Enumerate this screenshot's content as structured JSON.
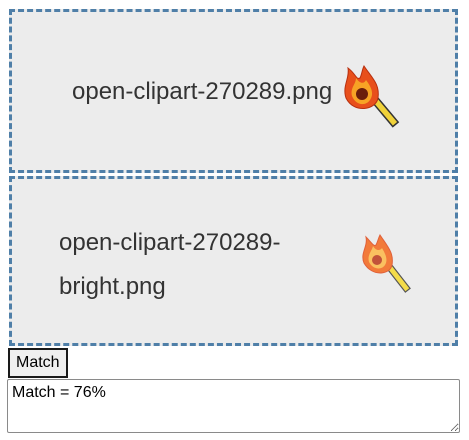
{
  "images": [
    {
      "filename": "open-clipart-270289.png",
      "icon": "match-stick-fire-icon"
    },
    {
      "filename": "open-clipart-270289-bright.png",
      "filename_line1": "open-clipart-270289-",
      "filename_line2": "bright.png",
      "icon": "match-stick-fire-bright-icon"
    }
  ],
  "controls": {
    "match_button_label": "Match",
    "result_text": "Match = 76%"
  },
  "colors": {
    "panel_border": "#4f7fa8",
    "panel_background": "#ececec"
  }
}
